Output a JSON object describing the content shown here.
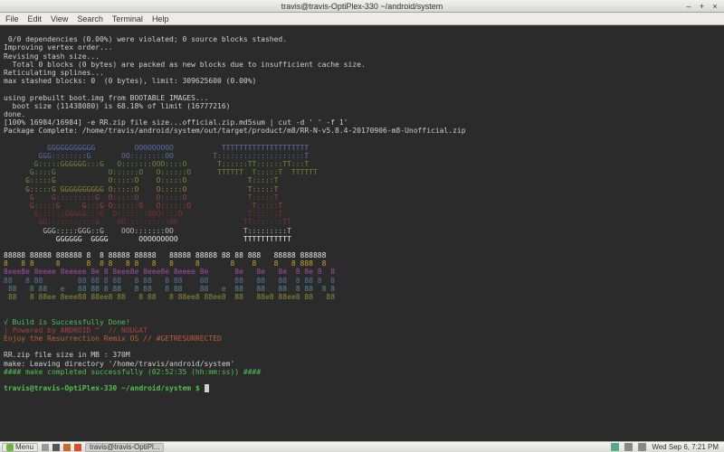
{
  "window": {
    "title": "travis@travis-OptiPlex-330 ~/android/system",
    "menu": [
      "File",
      "Edit",
      "View",
      "Search",
      "Terminal",
      "Help"
    ],
    "controls": {
      "min": "–",
      "max": "+",
      "close": "×"
    }
  },
  "build_output": {
    "l1": " 0/0 dependencies (0.00%) were violated; 0 source blocks stashed.",
    "l2": "Improving vertex order...",
    "l3": "Revising stash size...",
    "l4": "  Total 0 blocks (0 bytes) are packed as new blocks due to insufficient cache size.",
    "l5": "Reticulating splines...",
    "l6": "max stashed blocks: 0  (0 bytes), limit: 309625600 (0.00%)",
    "l7": "",
    "l8": "using prebuilt boot.img from BOOTABLE IMAGES...",
    "l9": "  boot size (11438080) is 68.18% of limit (16777216)",
    "l10": "done.",
    "l11": "[100% 16984/16984] -e RR.zip file size...official.zip.md5sum | cut -d ' ' -f 1'",
    "l12": "Package Complete: /home/travis/android/system/out/target/product/m8/RR-N-v5.8.4-20170906-m8-Unofficial.zip"
  },
  "ascii_art": {
    "g1": "          GGGGGGGGGGG         OOOOOOOOO           TTTTTTTTTTTTTTTTTTTT",
    "g2": "        GGG::::::::G       OO::::::::OO         T::::::::::::::::::::T",
    "g3": "       G:::::GGGGGG:::G   O:::::::OOO::::O       T::::::TT::::::TT:::T",
    "g4": "      G::::G            O::::::O   O::::::O      TTTTTT  T:::::T  TTTTTT",
    "g5": "     G:::::G            O:::::O    O:::::O              T:::::T",
    "g6": "     G:::::G GGGGGGGGGG O:::::O    O:::::O              T:::::T",
    "g7": "      G    G:::::::::G  O:::::O    O:::::O              T:::::T",
    "g8": "      G:::::G     G:::G O::::::O   O::::::O              T:::::T",
    "g9": "       G::::::GGGGG:::G  O:::::::OOO::::O               T::::::T",
    "g10": "        GG:::::::::::G    OO::::::::::OO               TT:::::::TT",
    "g11": "         GGG:::::GGG::G    OOO:::::::OO                T:::::::::T",
    "g12": "            GGGGGG  GGGG       OOOOOOOOO               TTTTTTTTTTT"
  },
  "rr_art": {
    "r1": "88888 88888 888888 8  8 88888 88888   88888 88888 88 88 888   88888 888888",
    "r2": "8   8 8     8      8  8 8   8 8   8   8     8       8    8    8   8 888  8",
    "r3": "8eee8e 8eeee 8eeeee 8e 8 8eee8e 8eee8e 8eeee 8e      8e   8e   8e  8 8e 8  8",
    "r4": "88   8 88        88 88 8 88   8 88   8 88    88      88   88   88  8 88 8  8",
    "r5": " 88   8 88   e   88 88 8 88   8 88   8 88    88   e  88   88   88  8 88  8 8",
    "r6": " 88   8 88ee 8eee88 88ee8 88   8 88   8 88ee8 88ee8  88   88e8 88ee8 88   88"
  },
  "status": {
    "build_done": "√ Build is Successfully Done!",
    "powered": "| Powered by ANDROID ™  // NOUGAT",
    "enjoy": "Enjoy the Resurrection Remix OS // #GETRESURRECTED",
    "zip_size": "RR.zip file size in MB : 370M",
    "make_leave": "make: Leaving directory '/home/travis/android/system'",
    "make_done": "#### make completed successfully (02:52:35 (hh:mm:ss)) ####"
  },
  "prompt": {
    "user_host": "travis@travis-OptiPlex-330",
    "path": " ~/android/system $ "
  },
  "taskbar": {
    "menu_label": "Menu",
    "app_label": "travis@travis-OptiPl...",
    "clock": "Wed Sep 6,  7:21 PM"
  }
}
